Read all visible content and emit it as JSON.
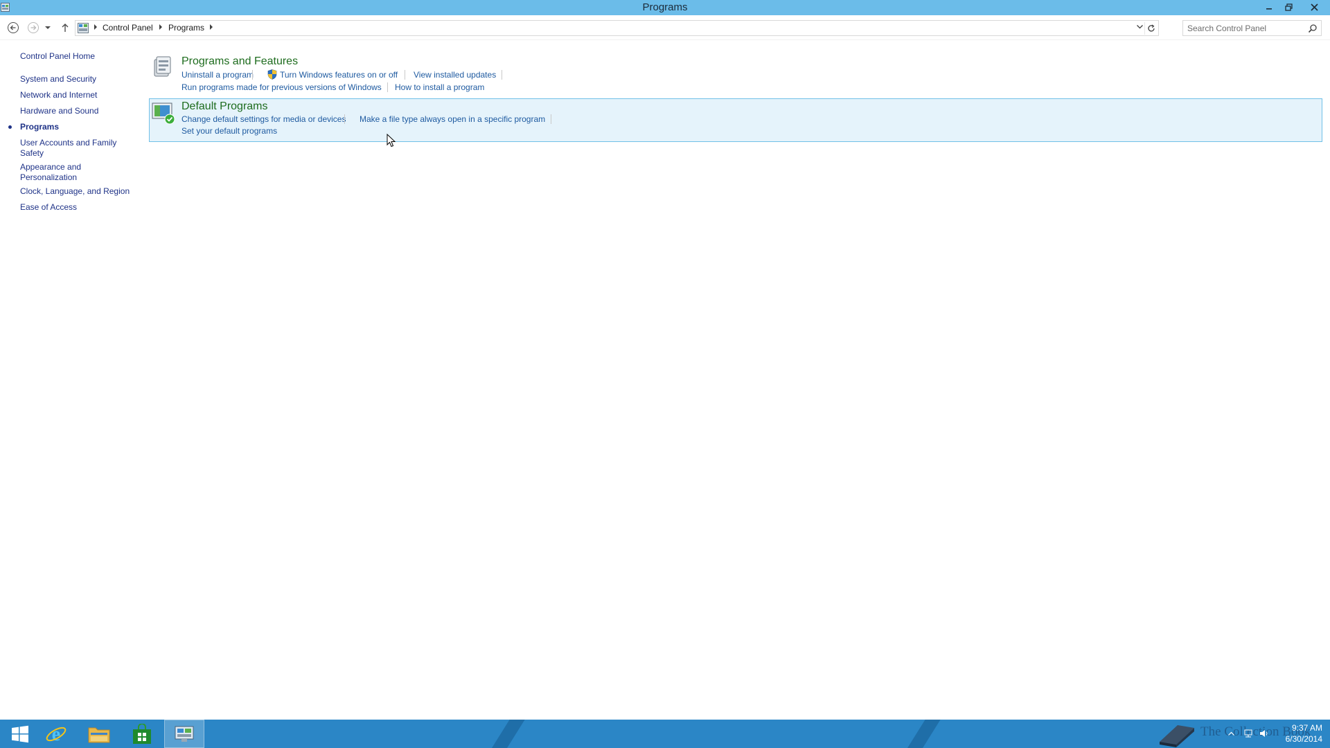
{
  "window": {
    "title": "Programs",
    "icon": "control-panel-icon",
    "controls": {
      "minimize": "minimize-icon",
      "maximize": "restore-icon",
      "close": "close-icon"
    }
  },
  "address_bar": {
    "crumbs": [
      "Control Panel",
      "Programs"
    ],
    "search_placeholder": "Search Control Panel"
  },
  "left_nav": {
    "home": "Control Panel Home",
    "items": [
      {
        "label": "System and Security",
        "active": false
      },
      {
        "label": "Network and Internet",
        "active": false
      },
      {
        "label": "Hardware and Sound",
        "active": false
      },
      {
        "label": "Programs",
        "active": true
      },
      {
        "label": "User Accounts and Family Safety",
        "active": false
      },
      {
        "label": "Appearance and Personalization",
        "active": false
      },
      {
        "label": "Clock, Language, and Region",
        "active": false
      },
      {
        "label": "Ease of Access",
        "active": false
      }
    ]
  },
  "sections": [
    {
      "title": "Programs and Features",
      "icon": "programs-features-icon",
      "links": [
        "Uninstall a program",
        "Turn Windows features on or off",
        "View installed updates",
        "Run programs made for previous versions of Windows",
        "How to install a program"
      ]
    },
    {
      "title": "Default Programs",
      "icon": "default-programs-icon",
      "highlighted": true,
      "links": [
        "Change default settings for media or devices",
        "Make a file type always open in a specific program",
        "Set your default programs"
      ]
    }
  ],
  "taskbar": {
    "pinned": [
      "start-icon",
      "internet-explorer-icon",
      "file-explorer-icon",
      "store-icon",
      "control-panel-icon"
    ],
    "watermark": "The Collection Book",
    "clock": {
      "time": "9:37 AM",
      "date": "6/30/2014"
    }
  },
  "colors": {
    "titlebar": "#6bbce9",
    "taskbar": "#2b86c6",
    "link": "#1e5aa0",
    "section_title": "#1e6c1e",
    "highlight_bg": "#e5f3fb",
    "highlight_border": "#70c0e7"
  }
}
